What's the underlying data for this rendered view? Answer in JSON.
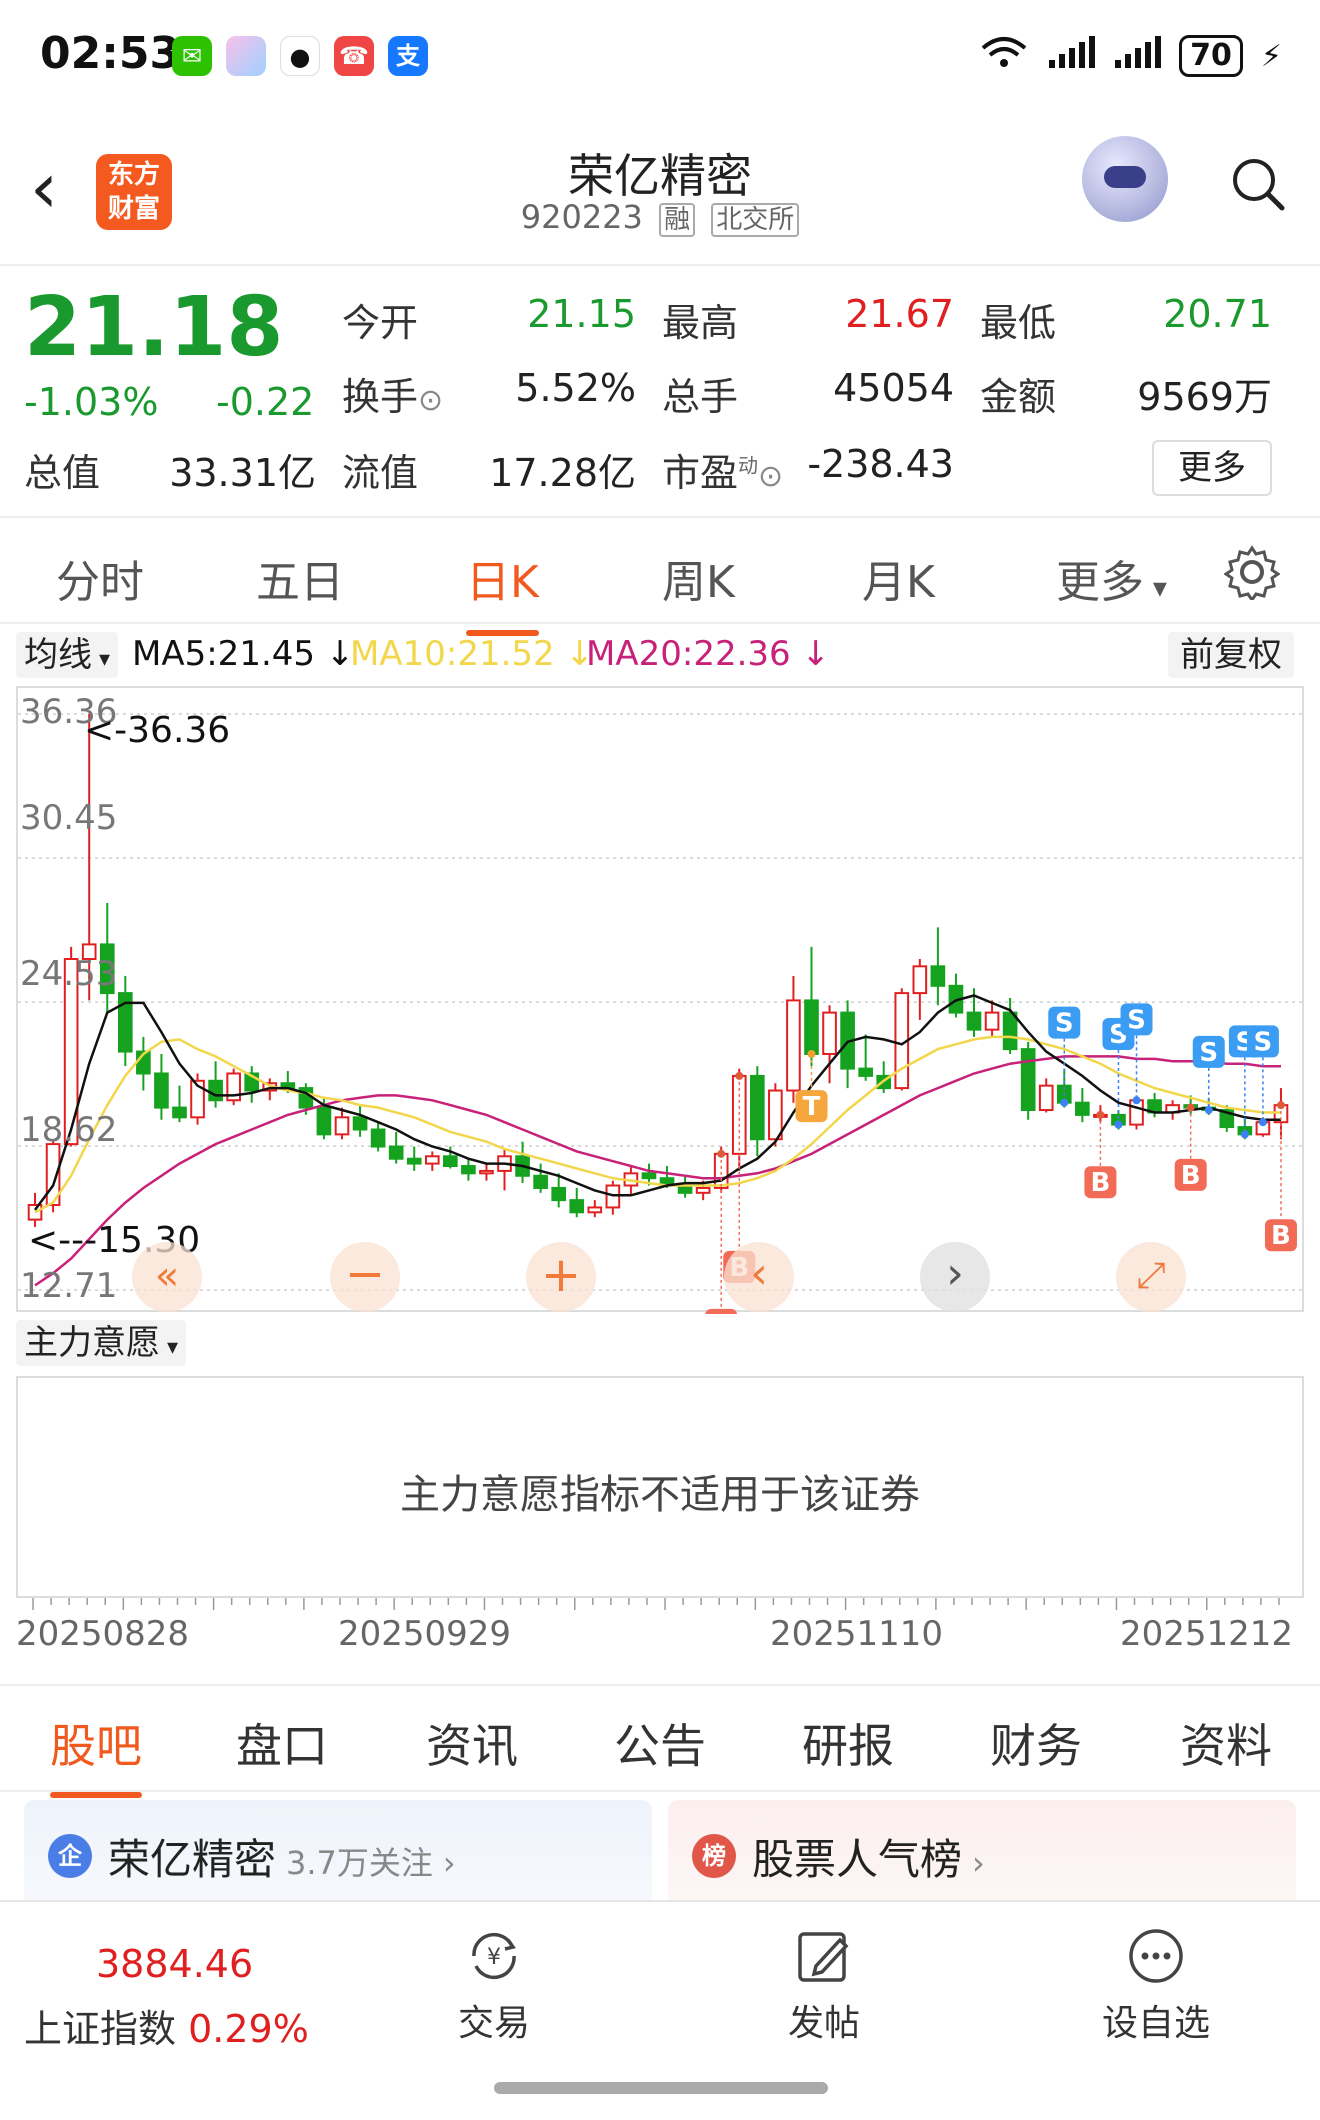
{
  "status_bar": {
    "time": "02:53",
    "battery": "70"
  },
  "header": {
    "title": "荣亿精密",
    "code": "920223",
    "tag_margin": "融",
    "tag_exchange": "北交所",
    "logo_line1": "东方",
    "logo_line2": "财富"
  },
  "quote": {
    "price": "21.18",
    "change_pct": "-1.03%",
    "change": "-0.22",
    "open_label": "今开",
    "open": "21.15",
    "high_label": "最高",
    "high": "21.67",
    "low_label": "最低",
    "low": "20.71",
    "turnover_label": "换手",
    "turnover": "5.52%",
    "volume_label": "总手",
    "volume": "45054",
    "amount_label": "金额",
    "amount": "9569万",
    "mktcap_label": "总值",
    "mktcap": "33.31亿",
    "float_label": "流值",
    "float_cap": "17.28亿",
    "pe_label": "市盈",
    "pe_sup": "动",
    "pe": "-238.43",
    "more": "更多"
  },
  "period_tabs": [
    "分时",
    "五日",
    "日K",
    "周K",
    "月K",
    "更多"
  ],
  "chart_header": {
    "ma_button": "均线",
    "ma5": "MA5:21.45 ↓",
    "ma10": "MA10:21.52 ↓",
    "ma20": "MA20:22.36 ↓",
    "adjust": "前复权",
    "colors": {
      "ma5": "#111111",
      "ma10": "#f2d64b",
      "ma20": "#c8217a",
      "up": "#e02020",
      "down": "#15a21f"
    }
  },
  "chart_data": {
    "type": "candlestick",
    "y_ticks": [
      "36.36",
      "30.45",
      "24.53",
      "18.62",
      "12.71"
    ],
    "y_range": [
      12.71,
      36.36
    ],
    "max_marker": "<-36.36",
    "min_marker": "<---15.30",
    "x_labels": [
      "20250828",
      "20250929",
      "20251110",
      "20251212"
    ],
    "candles": [
      [
        15.6,
        16.7,
        15.3,
        16.2
      ],
      [
        16.2,
        18.9,
        15.9,
        18.7
      ],
      [
        18.7,
        26.8,
        18.6,
        26.3
      ],
      [
        26.3,
        36.36,
        24.6,
        26.9
      ],
      [
        26.9,
        28.6,
        24.1,
        24.9
      ],
      [
        24.9,
        25.6,
        21.9,
        22.5
      ],
      [
        22.5,
        23.1,
        20.9,
        21.6
      ],
      [
        21.6,
        22.4,
        19.7,
        20.2
      ],
      [
        20.2,
        21.1,
        19.6,
        19.8
      ],
      [
        19.8,
        21.6,
        19.5,
        21.3
      ],
      [
        21.3,
        22.1,
        20.2,
        20.5
      ],
      [
        20.5,
        21.8,
        20.3,
        21.6
      ],
      [
        21.6,
        21.9,
        20.4,
        20.9
      ],
      [
        20.9,
        21.4,
        20.5,
        21.2
      ],
      [
        21.2,
        21.7,
        20.8,
        21.0
      ],
      [
        21.0,
        21.2,
        19.9,
        20.2
      ],
      [
        20.2,
        20.6,
        18.9,
        19.1
      ],
      [
        19.1,
        20.2,
        18.9,
        19.8
      ],
      [
        19.8,
        20.3,
        19.0,
        19.3
      ],
      [
        19.3,
        19.6,
        18.4,
        18.6
      ],
      [
        18.6,
        19.2,
        17.9,
        18.1
      ],
      [
        18.1,
        18.6,
        17.6,
        17.9
      ],
      [
        17.9,
        18.4,
        17.6,
        18.2
      ],
      [
        18.2,
        18.6,
        17.7,
        17.8
      ],
      [
        17.8,
        18.1,
        17.2,
        17.5
      ],
      [
        17.5,
        17.9,
        17.2,
        17.6
      ],
      [
        17.6,
        18.5,
        16.8,
        18.2
      ],
      [
        18.2,
        18.8,
        17.1,
        17.4
      ],
      [
        17.4,
        17.9,
        16.7,
        16.9
      ],
      [
        16.9,
        17.5,
        16.1,
        16.4
      ],
      [
        16.4,
        16.9,
        15.7,
        15.9
      ],
      [
        15.9,
        16.4,
        15.7,
        16.1
      ],
      [
        16.1,
        17.2,
        15.8,
        17.0
      ],
      [
        17.0,
        17.8,
        16.6,
        17.5
      ],
      [
        17.5,
        17.9,
        17.0,
        17.3
      ],
      [
        17.3,
        17.8,
        16.9,
        17.0
      ],
      [
        17.0,
        17.4,
        16.5,
        16.7
      ],
      [
        16.7,
        17.2,
        16.4,
        16.9
      ],
      [
        16.9,
        18.6,
        16.7,
        18.3
      ],
      [
        18.3,
        21.8,
        17.6,
        21.5
      ],
      [
        21.5,
        21.9,
        18.2,
        18.9
      ],
      [
        18.9,
        21.2,
        18.6,
        20.9
      ],
      [
        20.9,
        25.6,
        20.4,
        24.6
      ],
      [
        24.6,
        26.8,
        21.9,
        22.4
      ],
      [
        22.4,
        24.4,
        21.2,
        24.1
      ],
      [
        24.1,
        24.6,
        21.0,
        21.8
      ],
      [
        21.8,
        23.2,
        21.3,
        21.5
      ],
      [
        21.5,
        22.1,
        20.8,
        21.0
      ],
      [
        21.0,
        25.1,
        20.9,
        24.9
      ],
      [
        24.9,
        26.3,
        23.8,
        26.0
      ],
      [
        26.0,
        27.6,
        24.4,
        25.2
      ],
      [
        25.2,
        25.7,
        23.9,
        24.1
      ],
      [
        24.1,
        25.1,
        23.1,
        23.4
      ],
      [
        23.4,
        24.6,
        23.1,
        24.1
      ],
      [
        24.1,
        24.7,
        22.4,
        22.6
      ],
      [
        22.6,
        22.9,
        19.7,
        20.1
      ],
      [
        20.1,
        21.4,
        20.0,
        21.1
      ],
      [
        21.1,
        21.8,
        20.2,
        20.4
      ],
      [
        20.4,
        21.0,
        19.6,
        19.9
      ],
      [
        19.9,
        20.3,
        19.6,
        19.9
      ],
      [
        19.9,
        20.1,
        19.3,
        19.5
      ],
      [
        19.5,
        20.7,
        19.3,
        20.5
      ],
      [
        20.5,
        20.8,
        19.8,
        20.0
      ],
      [
        20.0,
        20.5,
        19.7,
        20.3
      ],
      [
        20.3,
        20.7,
        19.9,
        20.2
      ],
      [
        20.2,
        20.6,
        19.9,
        20.1
      ],
      [
        20.1,
        20.3,
        19.2,
        19.4
      ],
      [
        19.4,
        19.8,
        18.9,
        19.1
      ],
      [
        19.1,
        19.8,
        19.0,
        19.6
      ],
      [
        19.6,
        21.0,
        18.9,
        20.3
      ]
    ],
    "ma5": [
      16.0,
      17.0,
      19.3,
      22.0,
      24.1,
      24.5,
      24.5,
      23.3,
      22.0,
      21.1,
      20.7,
      20.7,
      20.8,
      21.0,
      21.0,
      20.8,
      20.3,
      20.1,
      19.9,
      19.6,
      19.3,
      18.9,
      18.6,
      18.4,
      18.1,
      17.9,
      17.9,
      17.8,
      17.6,
      17.4,
      17.1,
      16.8,
      16.6,
      16.6,
      16.8,
      17.0,
      17.1,
      17.1,
      17.2,
      17.7,
      18.1,
      18.8,
      20.0,
      21.1,
      22.0,
      22.9,
      23.1,
      23.0,
      22.8,
      23.3,
      24.1,
      24.6,
      24.8,
      24.5,
      24.2,
      23.3,
      22.5,
      22.0,
      21.5,
      20.9,
      20.4,
      20.2,
      20.0,
      20.0,
      20.1,
      20.2,
      20.0,
      19.8,
      19.7,
      19.7
    ],
    "ma10": [
      15.9,
      16.3,
      17.4,
      18.9,
      20.3,
      21.5,
      22.4,
      22.9,
      23.0,
      22.6,
      22.3,
      21.9,
      21.5,
      21.1,
      20.9,
      20.8,
      20.6,
      20.5,
      20.3,
      20.2,
      20.0,
      19.8,
      19.5,
      19.2,
      19.0,
      18.8,
      18.5,
      18.3,
      18.1,
      17.9,
      17.7,
      17.5,
      17.3,
      17.2,
      17.1,
      17.0,
      17.0,
      17.0,
      17.0,
      17.1,
      17.3,
      17.6,
      18.1,
      18.7,
      19.4,
      20.1,
      20.7,
      21.3,
      21.8,
      22.2,
      22.6,
      22.8,
      23.0,
      23.1,
      23.1,
      23.0,
      22.8,
      22.6,
      22.3,
      22.0,
      21.6,
      21.3,
      21.0,
      20.8,
      20.6,
      20.4,
      20.2,
      20.1,
      20.0,
      20.0
    ],
    "ma20": [
      12.9,
      13.4,
      14.0,
      14.8,
      15.6,
      16.3,
      16.9,
      17.4,
      17.9,
      18.3,
      18.7,
      19.0,
      19.3,
      19.6,
      19.9,
      20.1,
      20.3,
      20.5,
      20.6,
      20.7,
      20.7,
      20.6,
      20.5,
      20.3,
      20.1,
      19.9,
      19.6,
      19.3,
      19.0,
      18.7,
      18.4,
      18.2,
      18.0,
      17.8,
      17.6,
      17.5,
      17.4,
      17.3,
      17.3,
      17.4,
      17.5,
      17.7,
      18.0,
      18.3,
      18.7,
      19.1,
      19.5,
      19.9,
      20.3,
      20.7,
      21.0,
      21.3,
      21.6,
      21.8,
      22.0,
      22.1,
      22.2,
      22.3,
      22.3,
      22.3,
      22.3,
      22.2,
      22.2,
      22.1,
      22.1,
      22.1,
      22.0,
      22.0,
      21.9,
      21.9
    ],
    "signals": [
      {
        "type": "B",
        "index": 38,
        "row": 2
      },
      {
        "type": "B",
        "index": 39,
        "row": 1
      },
      {
        "type": "T",
        "index": 43,
        "row": 0
      },
      {
        "type": "S",
        "index": 57,
        "row": 0
      },
      {
        "type": "S",
        "index": 60,
        "row": 1
      },
      {
        "type": "S",
        "index": 61,
        "row": 1
      },
      {
        "type": "S",
        "index": 65,
        "row": 0
      },
      {
        "type": "S",
        "index": 67,
        "row": 1
      },
      {
        "type": "S",
        "index": 68,
        "row": 1
      },
      {
        "type": "B",
        "index": 59,
        "row": 0
      },
      {
        "type": "B",
        "index": 64,
        "row": 0
      },
      {
        "type": "B",
        "index": 69,
        "row": 1
      }
    ]
  },
  "zhuli": {
    "label": "主力意愿",
    "message": "主力意愿指标不适用于该证券"
  },
  "bottom_tabs": [
    "股吧",
    "盘口",
    "资讯",
    "公告",
    "研报",
    "财务",
    "资料"
  ],
  "cards": [
    {
      "icon": "企",
      "title": "荣亿精密",
      "sub": "3.7万关注"
    },
    {
      "icon": "榜",
      "title": "股票人气榜",
      "sub": ""
    }
  ],
  "footer": {
    "index_value": "3884.46",
    "index_name": "上证指数",
    "index_pct": "0.29%",
    "trade": "交易",
    "post": "发帖",
    "set_watch": "设自选"
  }
}
